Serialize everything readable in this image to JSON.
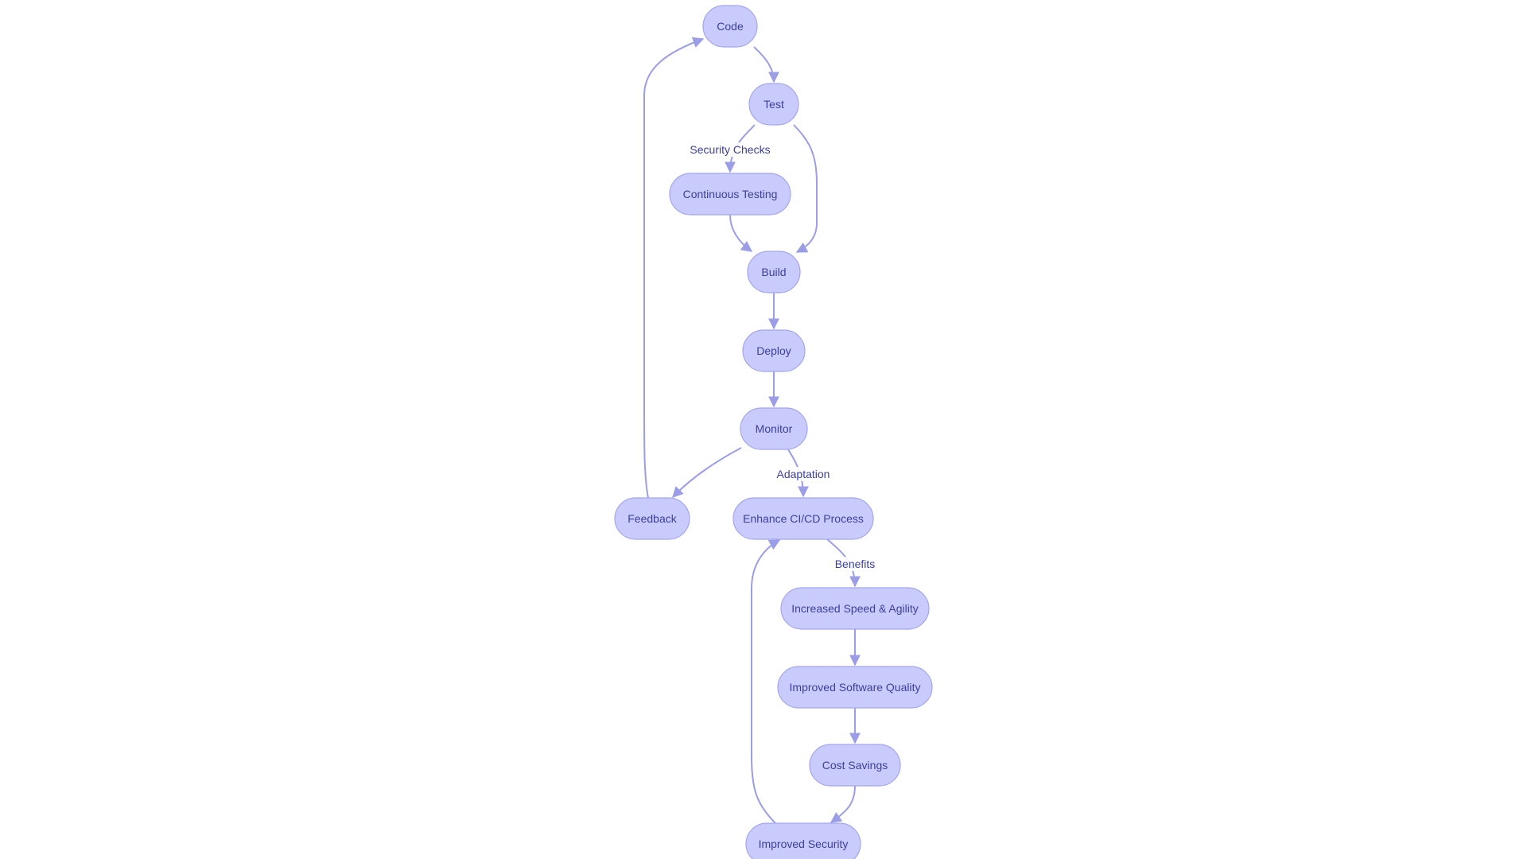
{
  "diagram": {
    "type": "flowchart",
    "colors": {
      "node_fill": "#c9cbfd",
      "node_stroke": "#a3a6ec",
      "text": "#3b3f9c",
      "edge": "#9b9ee6"
    },
    "nodes": [
      {
        "id": "code",
        "label": "Code"
      },
      {
        "id": "test",
        "label": "Test"
      },
      {
        "id": "continuous_testing",
        "label": "Continuous Testing"
      },
      {
        "id": "build",
        "label": "Build"
      },
      {
        "id": "deploy",
        "label": "Deploy"
      },
      {
        "id": "monitor",
        "label": "Monitor"
      },
      {
        "id": "feedback",
        "label": "Feedback"
      },
      {
        "id": "enhance",
        "label": "Enhance CI/CD Process"
      },
      {
        "id": "speed",
        "label": "Increased Speed & Agility"
      },
      {
        "id": "quality",
        "label": "Improved Software Quality"
      },
      {
        "id": "cost",
        "label": "Cost Savings"
      },
      {
        "id": "security",
        "label": "Improved Security"
      }
    ],
    "edges": [
      {
        "from": "code",
        "to": "test",
        "label": ""
      },
      {
        "from": "test",
        "to": "continuous_testing",
        "label": "Security Checks"
      },
      {
        "from": "test",
        "to": "build",
        "label": ""
      },
      {
        "from": "continuous_testing",
        "to": "build",
        "label": ""
      },
      {
        "from": "build",
        "to": "deploy",
        "label": ""
      },
      {
        "from": "deploy",
        "to": "monitor",
        "label": ""
      },
      {
        "from": "monitor",
        "to": "feedback",
        "label": ""
      },
      {
        "from": "monitor",
        "to": "enhance",
        "label": "Adaptation"
      },
      {
        "from": "feedback",
        "to": "code",
        "label": ""
      },
      {
        "from": "enhance",
        "to": "speed",
        "label": "Benefits"
      },
      {
        "from": "speed",
        "to": "quality",
        "label": ""
      },
      {
        "from": "quality",
        "to": "cost",
        "label": ""
      },
      {
        "from": "cost",
        "to": "security",
        "label": ""
      },
      {
        "from": "security",
        "to": "enhance",
        "label": ""
      }
    ]
  }
}
